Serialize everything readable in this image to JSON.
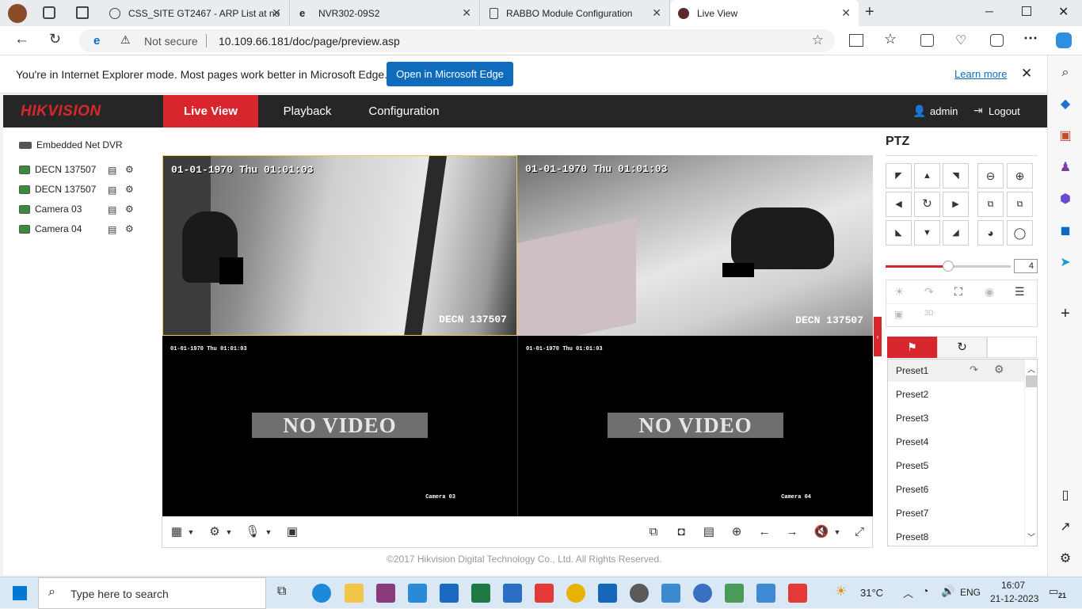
{
  "browser": {
    "tabs": [
      {
        "title": "CSS_SITE GT2467 - ARP List at no"
      },
      {
        "title": "NVR302-09S2"
      },
      {
        "title": "RABBO Module Configuration"
      },
      {
        "title": "Live View"
      }
    ],
    "security_label": "Not secure",
    "url": "10.109.66.181/doc/page/preview.asp"
  },
  "ie_banner": {
    "message": "You're in Internet Explorer mode. Most pages work better in Microsoft Edge.",
    "open_button": "Open in Microsoft Edge",
    "learn_more": "Learn more"
  },
  "header": {
    "brand": "HIKVISION",
    "nav": [
      "Live View",
      "Playback",
      "Configuration"
    ],
    "user": "admin",
    "logout": "Logout"
  },
  "tree": {
    "root": "Embedded Net DVR",
    "cameras": [
      "DECN 137507",
      "DECN 137507",
      "Camera 03",
      "Camera 04"
    ]
  },
  "video": {
    "panes": [
      {
        "timestamp": "01-01-1970 Thu 01:01:03",
        "channel": "DECN 137507"
      },
      {
        "timestamp": "01-01-1970 Thu 01:01:03",
        "channel": "DECN 137507"
      },
      {
        "timestamp": "01-01-1970 Thu 01:01:03",
        "channel": "Camera 03",
        "overlay": "NO VIDEO"
      },
      {
        "timestamp": "01-01-1970 Thu 01:01:03",
        "channel": "Camera 04",
        "overlay": "NO VIDEO"
      }
    ]
  },
  "footer": "©2017 Hikvision Digital Technology Co., Ltd. All Rights Reserved.",
  "ptz": {
    "title": "PTZ",
    "speed": "4",
    "speed_fraction": 0.5,
    "presets": [
      "Preset1",
      "Preset2",
      "Preset3",
      "Preset4",
      "Preset5",
      "Preset6",
      "Preset7",
      "Preset8"
    ]
  },
  "taskbar": {
    "search_placeholder": "Type here to search",
    "temperature": "31°C",
    "language": "ENG",
    "time": "16:07",
    "date": "21-12-2023",
    "notifications": "21"
  },
  "colors": {
    "brand_red": "#d7262e",
    "nav_bg": "#262626",
    "edge_blue": "#0f6cbd"
  }
}
